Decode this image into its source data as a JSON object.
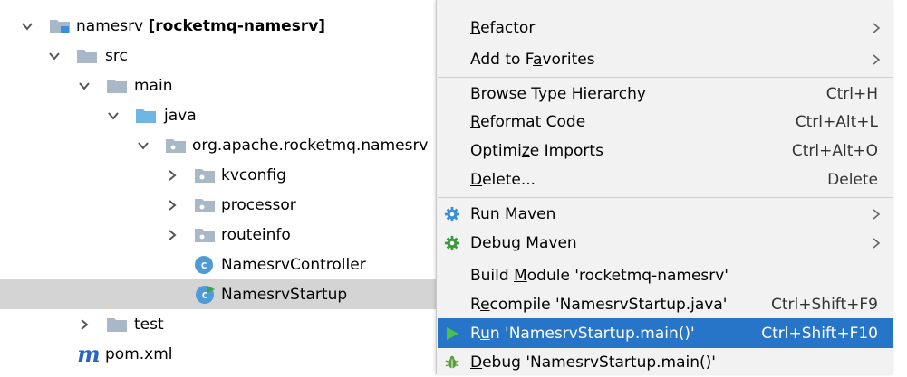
{
  "tree": {
    "items": [
      {
        "name_plain": "namesrv",
        "name_bold": "[rocketmq-namesrv]"
      },
      {
        "label": "src"
      },
      {
        "label": "main"
      },
      {
        "label": "java"
      },
      {
        "label": "org.apache.rocketmq.namesrv"
      },
      {
        "label": "kvconfig"
      },
      {
        "label": "processor"
      },
      {
        "label": "routeinfo"
      },
      {
        "label": "NamesrvController"
      },
      {
        "label": "NamesrvStartup"
      },
      {
        "label": "test"
      },
      {
        "label": "pom.xml"
      }
    ],
    "class_badge": "c",
    "maven_badge": "m"
  },
  "menu": {
    "refactor": {
      "pre": "",
      "u": "R",
      "post": "efactor"
    },
    "add_fav": {
      "pre": "Add to F",
      "u": "a",
      "post": "vorites"
    },
    "browse": {
      "label": "Browse Type Hierarchy",
      "shortcut": "Ctrl+H"
    },
    "reformat": {
      "pre": "",
      "u": "R",
      "post": "eformat Code",
      "shortcut": "Ctrl+Alt+L"
    },
    "optimize": {
      "pre": "Optimi",
      "u": "z",
      "post": "e Imports",
      "shortcut": "Ctrl+Alt+O"
    },
    "delete": {
      "pre": "",
      "u": "D",
      "post": "elete...",
      "shortcut": "Delete"
    },
    "run_maven": {
      "label": "Run Maven"
    },
    "debug_maven": {
      "label": "Debug Maven"
    },
    "build": {
      "pre": "Build ",
      "u": "M",
      "post": "odule 'rocketmq-namesrv'"
    },
    "recompile": {
      "pre": "R",
      "u": "e",
      "post": "compile 'NamesrvStartup.java'",
      "shortcut": "Ctrl+Shift+F9"
    },
    "run": {
      "pre": "R",
      "u": "u",
      "post": "n 'NamesrvStartup.main()'",
      "shortcut": "Ctrl+Shift+F10"
    },
    "debug": {
      "pre": "",
      "u": "D",
      "post": "ebug 'NamesrvStartup.main()'"
    }
  },
  "colors": {
    "highlight": "#2675c8",
    "folder": "#a9b8c6",
    "source_folder": "#6fb6e3",
    "selection": "#d4d4d4"
  }
}
